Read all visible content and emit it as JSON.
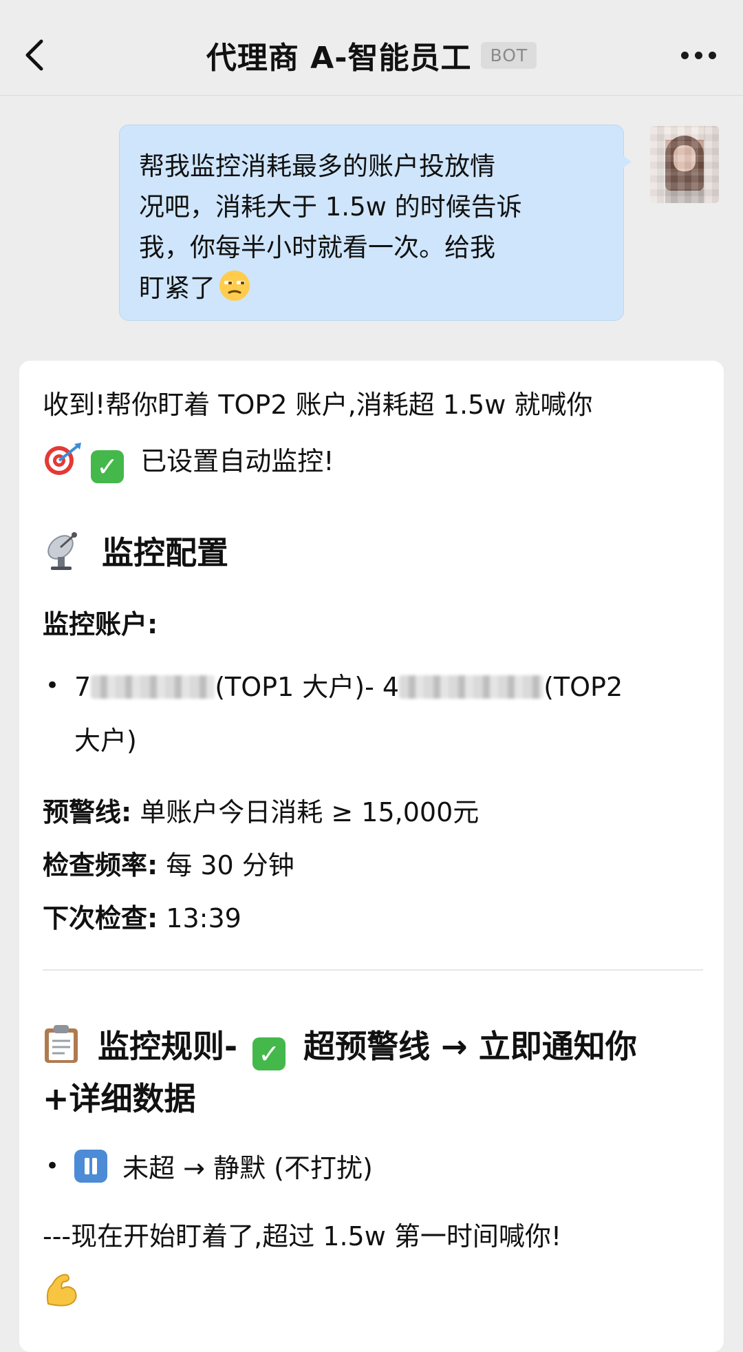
{
  "header": {
    "title": "代理商 A-智能员工",
    "badge": "BOT"
  },
  "user_message": {
    "line1": "帮我监控消耗最多的账户投放情",
    "line2": "况吧，消耗大于 1.5w 的时候告诉",
    "line3": "我，你每半小时就看一次。给我",
    "line4": "盯紧了"
  },
  "bot_message": {
    "intro_line1": "收到!帮你盯着 TOP2 账户,消耗超 1.5w 就喊你",
    "intro_line2": "已设置自动监控!",
    "config_heading": "监控配置",
    "accounts_label": "监控账户:",
    "account1_prefix": "7",
    "account1_tag": "(TOP1 大户)- 4",
    "account2_tag": "(TOP2",
    "account2_tag_cont": "大户)",
    "alert_label": "预警线:",
    "alert_value": " 单账户今日消耗 ≥ 15,000元",
    "freq_label": "检查频率:",
    "freq_value": " 每 30 分钟",
    "next_label": "下次检查:",
    "next_value": " 13:39",
    "rules_heading": "监控规则-",
    "rule1_text": "超预警线 → 立即通知你",
    "rule1_cont": "+详细数据",
    "rule2_text": "未超 → 静默 (不打扰)",
    "closing_line1": "---现在开始盯着了,超过 1.5w 第一时间喊你!"
  },
  "colors": {
    "background": "#ededed",
    "user_bubble": "#cfe5fb",
    "card": "#ffffff"
  },
  "icons": [
    "back-chevron-icon",
    "more-dots-icon",
    "unamused-face-icon",
    "target-dart-icon",
    "check-mark-icon",
    "satellite-dish-icon",
    "clipboard-icon",
    "pause-icon",
    "flexed-biceps-icon"
  ]
}
